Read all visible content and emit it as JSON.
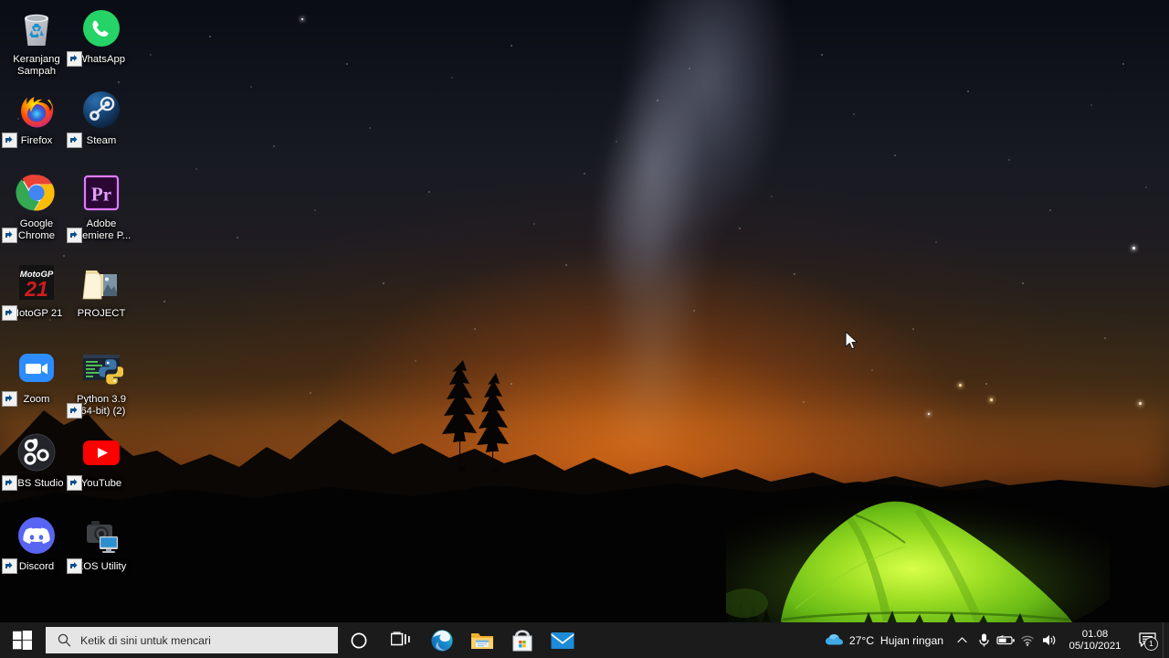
{
  "desktop": {
    "wallpaper_description": "Night sky with Milky Way over mountain silhouettes and a glowing green tent",
    "colors": {
      "taskbar_bg": "#1b1b1b",
      "search_bg": "#e5e5e5",
      "tent_green": "#7ed321",
      "horizon_orange": "#ff7a1e"
    },
    "icons": [
      {
        "label": "Keranjang Sampah",
        "name": "recycle-bin",
        "shortcut": false
      },
      {
        "label": "WhatsApp",
        "name": "whatsapp",
        "shortcut": true
      },
      {
        "label": "Firefox",
        "name": "firefox",
        "shortcut": true
      },
      {
        "label": "Steam",
        "name": "steam",
        "shortcut": true
      },
      {
        "label": "Google Chrome",
        "name": "google-chrome",
        "shortcut": true
      },
      {
        "label": "Adobe Premiere P...",
        "name": "adobe-premiere-pro",
        "shortcut": true
      },
      {
        "label": "MotoGP 21",
        "name": "motogp-21",
        "shortcut": true
      },
      {
        "label": "PROJECT",
        "name": "project-folder",
        "shortcut": false
      },
      {
        "label": "Zoom",
        "name": "zoom",
        "shortcut": true
      },
      {
        "label": "Python 3.9 (64-bit) (2)",
        "name": "python-39",
        "shortcut": true
      },
      {
        "label": "OBS Studio",
        "name": "obs-studio",
        "shortcut": true
      },
      {
        "label": "YouTube",
        "name": "youtube",
        "shortcut": true
      },
      {
        "label": "Discord",
        "name": "discord",
        "shortcut": true
      },
      {
        "label": "EOS Utility",
        "name": "eos-utility",
        "shortcut": true
      }
    ]
  },
  "taskbar": {
    "start_label": "Start",
    "search": {
      "placeholder": "Ketik di sini untuk mencari"
    },
    "buttons": [
      {
        "label": "Cortana",
        "icon": "cortana-icon"
      },
      {
        "label": "Task View",
        "icon": "task-view-icon"
      }
    ],
    "apps": [
      {
        "label": "Microsoft Edge",
        "icon": "edge-icon"
      },
      {
        "label": "File Explorer",
        "icon": "file-explorer-icon"
      },
      {
        "label": "Microsoft Store",
        "icon": "microsoft-store-icon"
      },
      {
        "label": "Mail",
        "icon": "mail-icon"
      }
    ],
    "tray": {
      "weather": {
        "icon": "cloud-icon",
        "temperature": "27°C",
        "condition": "Hujan ringan"
      },
      "icons": [
        {
          "name": "show-hidden-icons",
          "glyph": "chevron-up-icon"
        },
        {
          "name": "microphone",
          "glyph": "microphone-icon"
        },
        {
          "name": "battery",
          "glyph": "battery-icon"
        },
        {
          "name": "network",
          "glyph": "wifi-icon"
        },
        {
          "name": "volume",
          "glyph": "speaker-icon"
        }
      ],
      "clock": {
        "time": "01.08",
        "date": "05/10/2021"
      },
      "action_center": {
        "label": "Notifications",
        "badge": "1"
      }
    }
  }
}
